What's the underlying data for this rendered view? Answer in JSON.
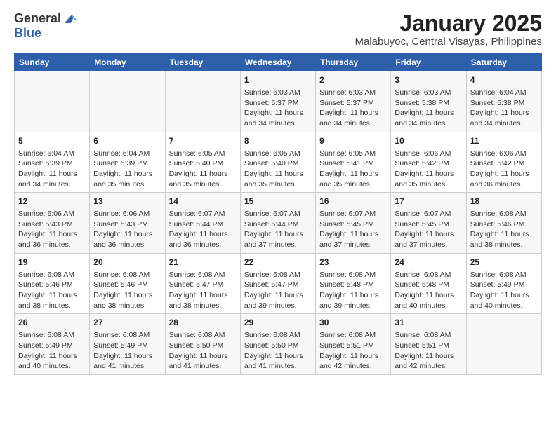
{
  "header": {
    "logo_line1": "General",
    "logo_line2": "Blue",
    "title": "January 2025",
    "subtitle": "Malabuyoc, Central Visayas, Philippines"
  },
  "weekdays": [
    "Sunday",
    "Monday",
    "Tuesday",
    "Wednesday",
    "Thursday",
    "Friday",
    "Saturday"
  ],
  "weeks": [
    [
      {
        "day": "",
        "info": ""
      },
      {
        "day": "",
        "info": ""
      },
      {
        "day": "",
        "info": ""
      },
      {
        "day": "1",
        "info": "Sunrise: 6:03 AM\nSunset: 5:37 PM\nDaylight: 11 hours and 34 minutes."
      },
      {
        "day": "2",
        "info": "Sunrise: 6:03 AM\nSunset: 5:37 PM\nDaylight: 11 hours and 34 minutes."
      },
      {
        "day": "3",
        "info": "Sunrise: 6:03 AM\nSunset: 5:38 PM\nDaylight: 11 hours and 34 minutes."
      },
      {
        "day": "4",
        "info": "Sunrise: 6:04 AM\nSunset: 5:38 PM\nDaylight: 11 hours and 34 minutes."
      }
    ],
    [
      {
        "day": "5",
        "info": "Sunrise: 6:04 AM\nSunset: 5:39 PM\nDaylight: 11 hours and 34 minutes."
      },
      {
        "day": "6",
        "info": "Sunrise: 6:04 AM\nSunset: 5:39 PM\nDaylight: 11 hours and 35 minutes."
      },
      {
        "day": "7",
        "info": "Sunrise: 6:05 AM\nSunset: 5:40 PM\nDaylight: 11 hours and 35 minutes."
      },
      {
        "day": "8",
        "info": "Sunrise: 6:05 AM\nSunset: 5:40 PM\nDaylight: 11 hours and 35 minutes."
      },
      {
        "day": "9",
        "info": "Sunrise: 6:05 AM\nSunset: 5:41 PM\nDaylight: 11 hours and 35 minutes."
      },
      {
        "day": "10",
        "info": "Sunrise: 6:06 AM\nSunset: 5:42 PM\nDaylight: 11 hours and 35 minutes."
      },
      {
        "day": "11",
        "info": "Sunrise: 6:06 AM\nSunset: 5:42 PM\nDaylight: 11 hours and 36 minutes."
      }
    ],
    [
      {
        "day": "12",
        "info": "Sunrise: 6:06 AM\nSunset: 5:43 PM\nDaylight: 11 hours and 36 minutes."
      },
      {
        "day": "13",
        "info": "Sunrise: 6:06 AM\nSunset: 5:43 PM\nDaylight: 11 hours and 36 minutes."
      },
      {
        "day": "14",
        "info": "Sunrise: 6:07 AM\nSunset: 5:44 PM\nDaylight: 11 hours and 36 minutes."
      },
      {
        "day": "15",
        "info": "Sunrise: 6:07 AM\nSunset: 5:44 PM\nDaylight: 11 hours and 37 minutes."
      },
      {
        "day": "16",
        "info": "Sunrise: 6:07 AM\nSunset: 5:45 PM\nDaylight: 11 hours and 37 minutes."
      },
      {
        "day": "17",
        "info": "Sunrise: 6:07 AM\nSunset: 5:45 PM\nDaylight: 11 hours and 37 minutes."
      },
      {
        "day": "18",
        "info": "Sunrise: 6:08 AM\nSunset: 5:46 PM\nDaylight: 11 hours and 38 minutes."
      }
    ],
    [
      {
        "day": "19",
        "info": "Sunrise: 6:08 AM\nSunset: 5:46 PM\nDaylight: 11 hours and 38 minutes."
      },
      {
        "day": "20",
        "info": "Sunrise: 6:08 AM\nSunset: 5:46 PM\nDaylight: 11 hours and 38 minutes."
      },
      {
        "day": "21",
        "info": "Sunrise: 6:08 AM\nSunset: 5:47 PM\nDaylight: 11 hours and 38 minutes."
      },
      {
        "day": "22",
        "info": "Sunrise: 6:08 AM\nSunset: 5:47 PM\nDaylight: 11 hours and 39 minutes."
      },
      {
        "day": "23",
        "info": "Sunrise: 6:08 AM\nSunset: 5:48 PM\nDaylight: 11 hours and 39 minutes."
      },
      {
        "day": "24",
        "info": "Sunrise: 6:08 AM\nSunset: 5:48 PM\nDaylight: 11 hours and 40 minutes."
      },
      {
        "day": "25",
        "info": "Sunrise: 6:08 AM\nSunset: 5:49 PM\nDaylight: 11 hours and 40 minutes."
      }
    ],
    [
      {
        "day": "26",
        "info": "Sunrise: 6:08 AM\nSunset: 5:49 PM\nDaylight: 11 hours and 40 minutes."
      },
      {
        "day": "27",
        "info": "Sunrise: 6:08 AM\nSunset: 5:49 PM\nDaylight: 11 hours and 41 minutes."
      },
      {
        "day": "28",
        "info": "Sunrise: 6:08 AM\nSunset: 5:50 PM\nDaylight: 11 hours and 41 minutes."
      },
      {
        "day": "29",
        "info": "Sunrise: 6:08 AM\nSunset: 5:50 PM\nDaylight: 11 hours and 41 minutes."
      },
      {
        "day": "30",
        "info": "Sunrise: 6:08 AM\nSunset: 5:51 PM\nDaylight: 11 hours and 42 minutes."
      },
      {
        "day": "31",
        "info": "Sunrise: 6:08 AM\nSunset: 5:51 PM\nDaylight: 11 hours and 42 minutes."
      },
      {
        "day": "",
        "info": ""
      }
    ]
  ]
}
